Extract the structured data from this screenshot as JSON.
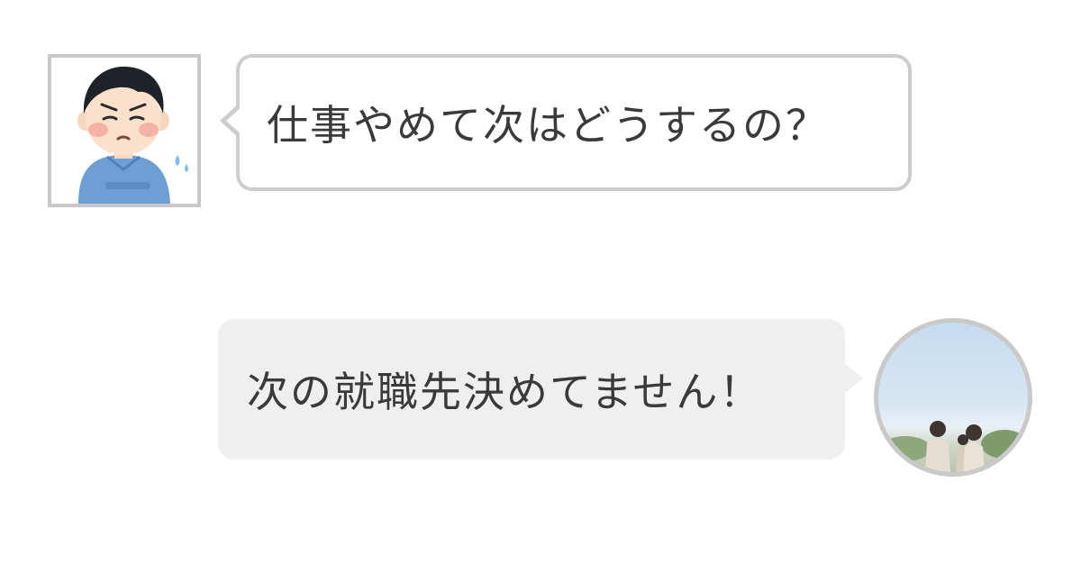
{
  "chat": {
    "messages": [
      {
        "side": "left",
        "avatar": "worried-man-illustration",
        "text": "仕事やめて次はどうするの？"
      },
      {
        "side": "right",
        "avatar": "family-photo",
        "text": "次の就職先決めてません！"
      }
    ]
  },
  "colors": {
    "incoming_bubble_border": "#cdcdcd",
    "incoming_bubble_bg": "#ffffff",
    "outgoing_bubble_bg": "#efefef",
    "text": "#3a3a3a",
    "avatar_border": "#c8c8c8"
  }
}
